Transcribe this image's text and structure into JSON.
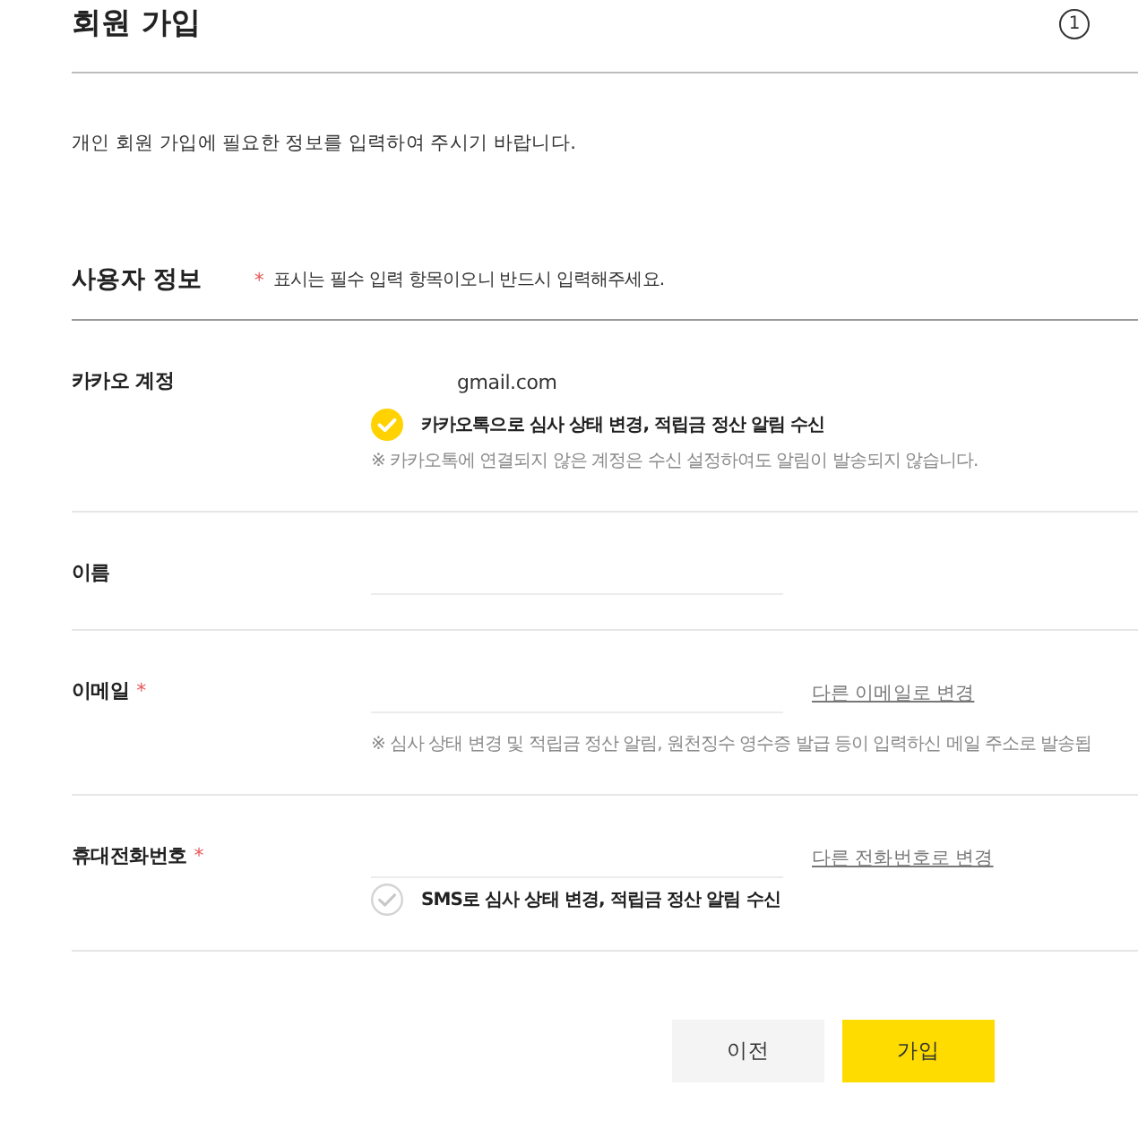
{
  "header": {
    "title": "회원 가입",
    "step": "1"
  },
  "intro": "개인 회원 가입에 필요한 정보를 입력하여 주시기 바랍니다.",
  "section": {
    "title": "사용자 정보",
    "required_mark": "*",
    "required_note": "표시는 필수 입력 항목이오니 반드시 입력해주세요."
  },
  "fields": [
    {
      "label": "카카오 계정",
      "kind": "text",
      "value": "gmail.com",
      "consent": {
        "label": "카카오톡으로 심사 상태 변경, 적립금 정산 알림 수신",
        "checked": true
      },
      "note": "※ 카카오톡에 연결되지 않은 계정은 수신 설정하여도 알림이 발송되지 않습니다."
    },
    {
      "label": "이름",
      "kind": "input"
    },
    {
      "label": "이메일",
      "kind": "input",
      "required_mark": "*",
      "link": "다른 이메일로 변경",
      "note": "※ 심사 상태 변경 및 적립금 정산 알림, 원천징수 영수증 발급 등이 입력하신 메일 주소로 발송됩"
    },
    {
      "label": "휴대전화번호",
      "kind": "input",
      "required_mark": "*",
      "link": "다른 전화번호로 변경",
      "consent": {
        "label": "SMS로 심사 상태 변경, 적립금 정산 알림 수신",
        "checked": false
      }
    }
  ],
  "buttons": [
    {
      "label": "이전",
      "kind": "secondary"
    },
    {
      "label": "가입",
      "kind": "primary"
    }
  ]
}
